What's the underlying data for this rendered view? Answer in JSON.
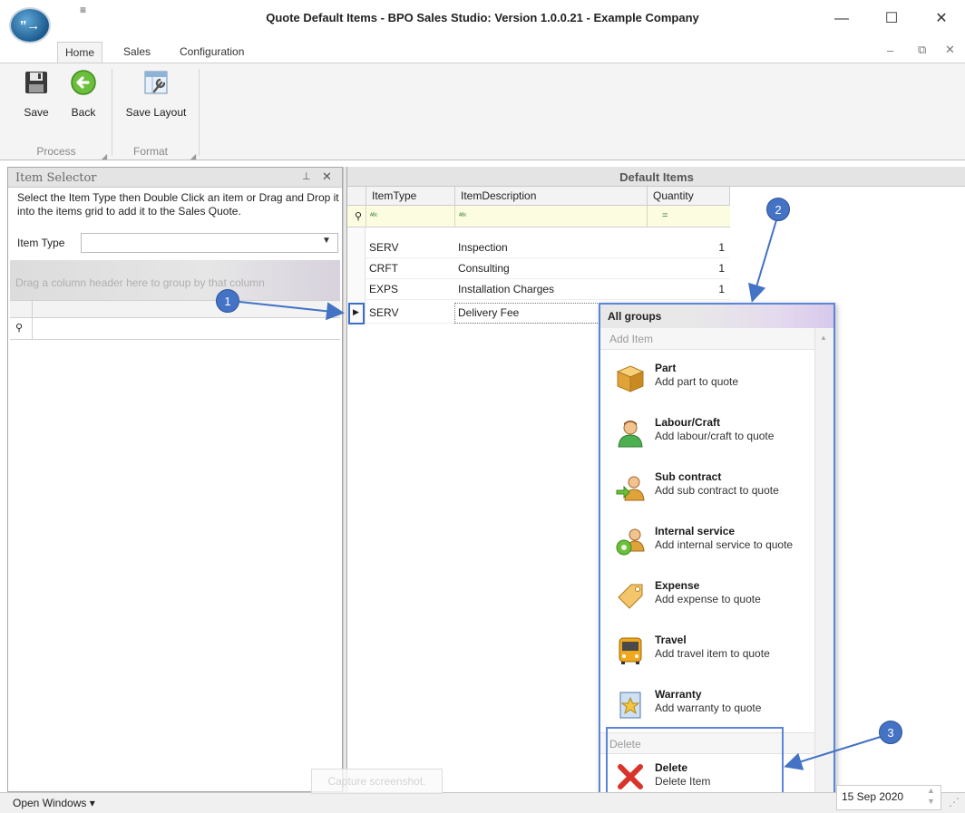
{
  "window": {
    "title": "Quote Default Items - BPO Sales Studio: Version 1.0.0.21 - Example Company",
    "logo_text": "”→",
    "qat_glyph": "≡",
    "minimize": "—",
    "maximize": "☐",
    "close": "✕"
  },
  "ribbon": {
    "tabs": [
      {
        "label": "Home",
        "active": true
      },
      {
        "label": "Sales",
        "active": false
      },
      {
        "label": "Configuration",
        "active": false
      }
    ],
    "mdi": {
      "minimize": "–",
      "restore": "⧉",
      "close": "✕"
    },
    "groups": {
      "process": {
        "label": "Process",
        "buttons": {
          "save": "Save",
          "back": "Back"
        }
      },
      "format": {
        "label": "Format",
        "buttons": {
          "save_layout": "Save Layout"
        }
      }
    }
  },
  "item_selector": {
    "caption": "Item Selector",
    "instructions": "Select the Item Type then Double Click an item or Drag and Drop it into the items grid to add it to the Sales Quote.",
    "item_type_label": "Item Type",
    "item_type_value": "",
    "group_panel_text": "Drag a column header here to group by that column"
  },
  "default_items": {
    "caption": "Default Items",
    "columns": [
      "ItemType",
      "ItemDescription",
      "Quantity"
    ],
    "filter_glyph": "=",
    "rows": [
      {
        "type": "SERV",
        "description": "Inspection",
        "quantity": "1"
      },
      {
        "type": "CRFT",
        "description": "Consulting",
        "quantity": "1"
      },
      {
        "type": "EXPS",
        "description": "Installation Charges",
        "quantity": "1"
      },
      {
        "type": "SERV",
        "description": "Delivery Fee",
        "quantity": ""
      }
    ]
  },
  "context_menu": {
    "header": "All groups",
    "add_section": "Add Item",
    "items": [
      {
        "title": "Part",
        "desc": "Add part to quote",
        "icon": "part-box-icon"
      },
      {
        "title": "Labour/Craft",
        "desc": "Add labour/craft to quote",
        "icon": "person-icon"
      },
      {
        "title": "Sub contract",
        "desc": "Add sub contract to quote",
        "icon": "subcontract-icon"
      },
      {
        "title": "Internal service",
        "desc": "Add internal service to quote",
        "icon": "internal-service-icon"
      },
      {
        "title": "Expense",
        "desc": "Add expense to quote",
        "icon": "price-tag-icon"
      },
      {
        "title": "Travel",
        "desc": "Add travel item to quote",
        "icon": "bus-icon"
      },
      {
        "title": "Warranty",
        "desc": "Add warranty to quote",
        "icon": "warranty-star-icon"
      }
    ],
    "delete_section": "Delete",
    "delete_item": {
      "title": "Delete",
      "desc": "Delete Item",
      "icon": "red-x-icon"
    }
  },
  "annotations": {
    "badge_1": "1",
    "badge_2": "2",
    "badge_3": "3"
  },
  "statusbar": {
    "open_windows": "Open Windows ▾",
    "capture": "Capture screenshot.",
    "date": "15 Sep 2020"
  },
  "colors": {
    "accent_blue": "#4472c4",
    "filter_row": "#fcfce0",
    "delete_red": "#d9342b"
  }
}
